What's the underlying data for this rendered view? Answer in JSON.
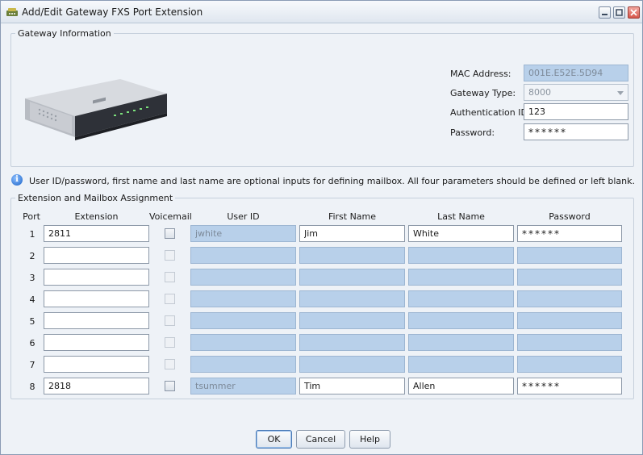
{
  "window": {
    "title": "Add/Edit Gateway FXS Port Extension"
  },
  "gateway": {
    "legend": "Gateway Information",
    "mac_label": "MAC Address:",
    "mac_value": "001E.E52E.5D94",
    "type_label": "Gateway Type:",
    "type_value": "8000",
    "auth_label": "Authentication ID:",
    "auth_value": "123",
    "password_label": "Password:",
    "password_value": "******"
  },
  "info": {
    "text": "User ID/password, first name and last name are optional inputs for defining mailbox.  All four parameters should be defined or left blank."
  },
  "assignment": {
    "legend": "Extension and Mailbox Assignment",
    "columns": [
      "Port",
      "Extension",
      "Voicemail",
      "User ID",
      "First Name",
      "Last Name",
      "Password"
    ],
    "rows": [
      {
        "port": "1",
        "extension": "2811",
        "voicemail": false,
        "voicemail_enabled": true,
        "user_id": "jwhite",
        "first_name": "Jim",
        "last_name": "White",
        "password": "******",
        "mailbox_enabled": true
      },
      {
        "port": "2",
        "extension": "",
        "voicemail": false,
        "voicemail_enabled": false,
        "user_id": "",
        "first_name": "",
        "last_name": "",
        "password": "",
        "mailbox_enabled": false
      },
      {
        "port": "3",
        "extension": "",
        "voicemail": false,
        "voicemail_enabled": false,
        "user_id": "",
        "first_name": "",
        "last_name": "",
        "password": "",
        "mailbox_enabled": false
      },
      {
        "port": "4",
        "extension": "",
        "voicemail": false,
        "voicemail_enabled": false,
        "user_id": "",
        "first_name": "",
        "last_name": "",
        "password": "",
        "mailbox_enabled": false
      },
      {
        "port": "5",
        "extension": "",
        "voicemail": false,
        "voicemail_enabled": false,
        "user_id": "",
        "first_name": "",
        "last_name": "",
        "password": "",
        "mailbox_enabled": false
      },
      {
        "port": "6",
        "extension": "",
        "voicemail": false,
        "voicemail_enabled": false,
        "user_id": "",
        "first_name": "",
        "last_name": "",
        "password": "",
        "mailbox_enabled": false
      },
      {
        "port": "7",
        "extension": "",
        "voicemail": false,
        "voicemail_enabled": false,
        "user_id": "",
        "first_name": "",
        "last_name": "",
        "password": "",
        "mailbox_enabled": false
      },
      {
        "port": "8",
        "extension": "2818",
        "voicemail": false,
        "voicemail_enabled": true,
        "user_id": "tsummer",
        "first_name": "Tim",
        "last_name": "Allen",
        "password": "******",
        "mailbox_enabled": true
      }
    ]
  },
  "buttons": {
    "ok": "OK",
    "cancel": "Cancel",
    "help": "Help"
  },
  "icons": {
    "app": "gateway-phone-icon",
    "info": "info-icon",
    "device": "gateway-device-image"
  },
  "colors": {
    "disabled_field": "#b8d0ea",
    "window_bg": "#eef2f7"
  }
}
